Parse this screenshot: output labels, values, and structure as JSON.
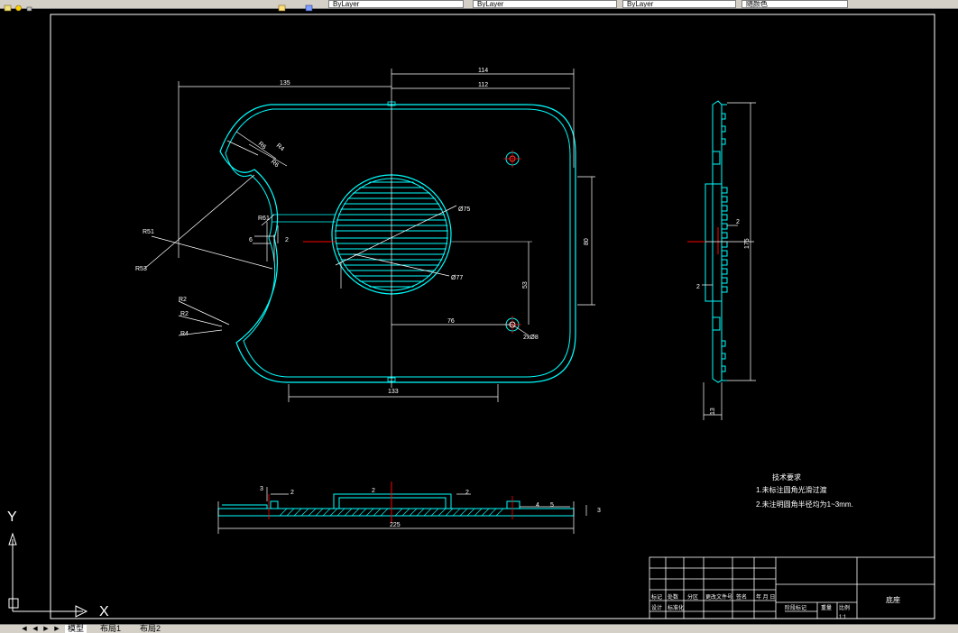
{
  "toolbar": {
    "fields": [
      "ByLayer",
      "ByLayer",
      "ByLayer",
      "随颜色"
    ]
  },
  "tabs": {
    "model": "模型",
    "layout1": "布局1",
    "layout2": "布局2"
  },
  "ucs": {
    "x_label": "X",
    "y_label": "Y"
  },
  "dimensions": {
    "top_overall": "114",
    "top_inner": "112",
    "left_top": "135",
    "right_height": "80",
    "bottom_width": "133",
    "circle_dia": "Ø75",
    "circle_dia2": "Ø77",
    "hole_dim_v": "53",
    "hole_dim_h": "76",
    "hole_note": "2xØ8",
    "r_r51": "R51",
    "r_r53": "R53",
    "r_r6_1": "R6",
    "r_r6_2": "R6",
    "r_r4": "R4",
    "r_r2": "R2",
    "r_r4b": "R4",
    "r_r2b": "R2",
    "r_r61": "R61",
    "side_width": "13",
    "side_height": "175",
    "side_step": "2",
    "side_step2": "2",
    "bottom_overall": "225",
    "bottom_2a": "2",
    "bottom_2b": "2",
    "bottom_2c": "2",
    "bottom_3a": "3",
    "bottom_3b": "3",
    "bottom_4": "4",
    "bottom_5": "5",
    "small_2": "2",
    "small_6": "6"
  },
  "notes": {
    "title": "技术要求",
    "line1": "1.未标注圆角光滑过渡",
    "line2": "2.未注明圆角半径均为1~3mm."
  },
  "titleblock": {
    "row1": [
      "标记",
      "处数",
      "分区",
      "更改文件号",
      "签名",
      "年 月 日"
    ],
    "row2": [
      "设计",
      "标准化"
    ],
    "stage": "阶段标记",
    "weight": "重量",
    "scale": "比例",
    "scale_value": "1:1",
    "name": "底座"
  },
  "colors": {
    "outline": "#00ffff",
    "dimension": "#ffffff",
    "center": "#ff0000",
    "background": "#000000"
  }
}
